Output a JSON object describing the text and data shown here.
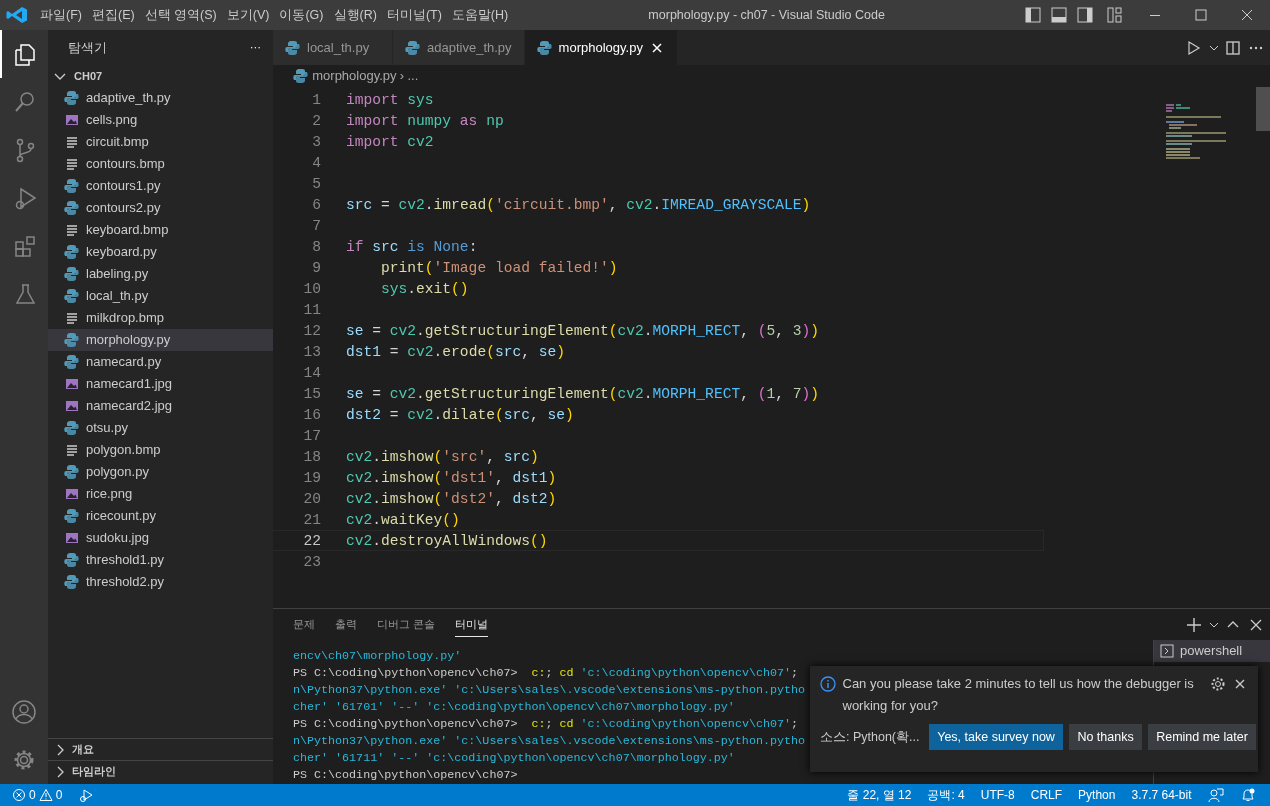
{
  "window": {
    "title": "morphology.py - ch07 - Visual Studio Code"
  },
  "menu": [
    "파일(F)",
    "편집(E)",
    "선택 영역(S)",
    "보기(V)",
    "이동(G)",
    "실행(R)",
    "터미널(T)",
    "도움말(H)"
  ],
  "activity_bar": [
    {
      "kind": "files",
      "selected": true
    },
    {
      "kind": "search",
      "selected": false
    },
    {
      "kind": "source",
      "selected": false
    },
    {
      "kind": "debug",
      "selected": false
    },
    {
      "kind": "extensions",
      "selected": false
    },
    {
      "kind": "flask",
      "selected": false
    }
  ],
  "sidebar": {
    "title": "탐색기",
    "more": "···",
    "folder": {
      "name": "CH07",
      "expanded": true
    },
    "items": [
      {
        "name": "adaptive_th.py",
        "kind": "py",
        "selected": false
      },
      {
        "name": "cells.png",
        "kind": "image",
        "selected": false
      },
      {
        "name": "circuit.bmp",
        "kind": "bmp",
        "selected": false
      },
      {
        "name": "contours.bmp",
        "kind": "bmp",
        "selected": false
      },
      {
        "name": "contours1.py",
        "kind": "py",
        "selected": false
      },
      {
        "name": "contours2.py",
        "kind": "py",
        "selected": false
      },
      {
        "name": "keyboard.bmp",
        "kind": "bmp",
        "selected": false
      },
      {
        "name": "keyboard.py",
        "kind": "py",
        "selected": false
      },
      {
        "name": "labeling.py",
        "kind": "py",
        "selected": false
      },
      {
        "name": "local_th.py",
        "kind": "py",
        "selected": false
      },
      {
        "name": "milkdrop.bmp",
        "kind": "bmp",
        "selected": false
      },
      {
        "name": "morphology.py",
        "kind": "py",
        "selected": true
      },
      {
        "name": "namecard.py",
        "kind": "py",
        "selected": false
      },
      {
        "name": "namecard1.jpg",
        "kind": "image",
        "selected": false
      },
      {
        "name": "namecard2.jpg",
        "kind": "image",
        "selected": false
      },
      {
        "name": "otsu.py",
        "kind": "py",
        "selected": false
      },
      {
        "name": "polygon.bmp",
        "kind": "bmp",
        "selected": false
      },
      {
        "name": "polygon.py",
        "kind": "py",
        "selected": false
      },
      {
        "name": "rice.png",
        "kind": "image",
        "selected": false
      },
      {
        "name": "ricecount.py",
        "kind": "py",
        "selected": false
      },
      {
        "name": "sudoku.jpg",
        "kind": "image",
        "selected": false
      },
      {
        "name": "threshold1.py",
        "kind": "py",
        "selected": false
      },
      {
        "name": "threshold2.py",
        "kind": "py",
        "selected": false
      }
    ],
    "sections": [
      {
        "label": "개요",
        "expanded": false
      },
      {
        "label": "타임라인",
        "expanded": false
      }
    ]
  },
  "tabs": [
    {
      "label": "local_th.py",
      "selected": false
    },
    {
      "label": "adaptive_th.py",
      "selected": false
    },
    {
      "label": "morphology.py",
      "selected": true
    }
  ],
  "breadcrumb": [
    "morphology.py",
    "›",
    "..."
  ],
  "code": [
    {
      "number": "1",
      "current": false,
      "tokens": [
        {
          "kind": "kw",
          "t": "import "
        },
        {
          "kind": "mod",
          "t": "sys"
        }
      ]
    },
    {
      "number": "2",
      "current": false,
      "tokens": [
        {
          "kind": "kw",
          "t": "import "
        },
        {
          "kind": "mod",
          "t": "numpy "
        },
        {
          "kind": "kw",
          "t": "as "
        },
        {
          "kind": "mod",
          "t": "np"
        }
      ]
    },
    {
      "number": "3",
      "current": false,
      "tokens": [
        {
          "kind": "kw",
          "t": "import "
        },
        {
          "kind": "mod",
          "t": "cv2"
        }
      ]
    },
    {
      "number": "4",
      "current": false
    },
    {
      "number": "5",
      "current": false
    },
    {
      "number": "6",
      "current": false,
      "tokens": [
        {
          "kind": "var",
          "t": "src"
        },
        {
          "kind": "op",
          "t": " = "
        },
        {
          "kind": "mod",
          "t": "cv2"
        },
        {
          "kind": "op",
          "t": "."
        },
        {
          "kind": "fn",
          "t": "imread"
        },
        {
          "kind": "p1",
          "t": "("
        },
        {
          "kind": "str",
          "t": "'circuit.bmp'"
        },
        {
          "kind": "op",
          "t": ", "
        },
        {
          "kind": "mod",
          "t": "cv2"
        },
        {
          "kind": "op",
          "t": "."
        },
        {
          "kind": "const",
          "t": "IMREAD_GRAYSCALE"
        },
        {
          "kind": "p1",
          "t": ")"
        }
      ]
    },
    {
      "number": "7",
      "current": false
    },
    {
      "number": "8",
      "current": false,
      "tokens": [
        {
          "kind": "kw",
          "t": "if "
        },
        {
          "kind": "var",
          "t": "src "
        },
        {
          "kind": "kw2",
          "t": "is None"
        },
        {
          "kind": "op",
          "t": ":"
        }
      ]
    },
    {
      "number": "9",
      "current": false,
      "tokens": [
        {
          "kind": "fn",
          "t": "    print"
        },
        {
          "kind": "p1",
          "t": "("
        },
        {
          "kind": "str",
          "t": "'Image load failed!'"
        },
        {
          "kind": "p1",
          "t": ")"
        }
      ]
    },
    {
      "number": "10",
      "current": false,
      "tokens": [
        {
          "kind": "mod",
          "t": "    sys"
        },
        {
          "kind": "op",
          "t": "."
        },
        {
          "kind": "fn",
          "t": "exit"
        },
        {
          "kind": "p1",
          "t": "()"
        }
      ]
    },
    {
      "number": "11",
      "current": false
    },
    {
      "number": "12",
      "current": false,
      "tokens": [
        {
          "kind": "var",
          "t": "se"
        },
        {
          "kind": "op",
          "t": " = "
        },
        {
          "kind": "mod",
          "t": "cv2"
        },
        {
          "kind": "op",
          "t": "."
        },
        {
          "kind": "fn",
          "t": "getStructuringElement"
        },
        {
          "kind": "p1",
          "t": "("
        },
        {
          "kind": "mod",
          "t": "cv2"
        },
        {
          "kind": "op",
          "t": "."
        },
        {
          "kind": "const",
          "t": "MORPH_RECT"
        },
        {
          "kind": "op",
          "t": ", "
        },
        {
          "kind": "p2",
          "t": "("
        },
        {
          "kind": "num",
          "t": "5"
        },
        {
          "kind": "op",
          "t": ", "
        },
        {
          "kind": "num",
          "t": "3"
        },
        {
          "kind": "p2",
          "t": ")"
        },
        {
          "kind": "p1",
          "t": ")"
        }
      ]
    },
    {
      "number": "13",
      "current": false,
      "tokens": [
        {
          "kind": "var",
          "t": "dst1"
        },
        {
          "kind": "op",
          "t": " = "
        },
        {
          "kind": "mod",
          "t": "cv2"
        },
        {
          "kind": "op",
          "t": "."
        },
        {
          "kind": "fn",
          "t": "erode"
        },
        {
          "kind": "p1",
          "t": "("
        },
        {
          "kind": "var",
          "t": "src"
        },
        {
          "kind": "op",
          "t": ", "
        },
        {
          "kind": "var",
          "t": "se"
        },
        {
          "kind": "p1",
          "t": ")"
        }
      ]
    },
    {
      "number": "14",
      "current": false
    },
    {
      "number": "15",
      "current": false,
      "tokens": [
        {
          "kind": "var",
          "t": "se"
        },
        {
          "kind": "op",
          "t": " = "
        },
        {
          "kind": "mod",
          "t": "cv2"
        },
        {
          "kind": "op",
          "t": "."
        },
        {
          "kind": "fn",
          "t": "getStructuringElement"
        },
        {
          "kind": "p1",
          "t": "("
        },
        {
          "kind": "mod",
          "t": "cv2"
        },
        {
          "kind": "op",
          "t": "."
        },
        {
          "kind": "const",
          "t": "MORPH_RECT"
        },
        {
          "kind": "op",
          "t": ", "
        },
        {
          "kind": "p2",
          "t": "("
        },
        {
          "kind": "num",
          "t": "1"
        },
        {
          "kind": "op",
          "t": ", "
        },
        {
          "kind": "num",
          "t": "7"
        },
        {
          "kind": "p2",
          "t": ")"
        },
        {
          "kind": "p1",
          "t": ")"
        }
      ]
    },
    {
      "number": "16",
      "current": false,
      "tokens": [
        {
          "kind": "var",
          "t": "dst2"
        },
        {
          "kind": "op",
          "t": " = "
        },
        {
          "kind": "mod",
          "t": "cv2"
        },
        {
          "kind": "op",
          "t": "."
        },
        {
          "kind": "fn",
          "t": "dilate"
        },
        {
          "kind": "p1",
          "t": "("
        },
        {
          "kind": "var",
          "t": "src"
        },
        {
          "kind": "op",
          "t": ", "
        },
        {
          "kind": "var",
          "t": "se"
        },
        {
          "kind": "p1",
          "t": ")"
        }
      ]
    },
    {
      "number": "17",
      "current": false
    },
    {
      "number": "18",
      "current": false,
      "tokens": [
        {
          "kind": "mod",
          "t": "cv2"
        },
        {
          "kind": "op",
          "t": "."
        },
        {
          "kind": "fn",
          "t": "imshow"
        },
        {
          "kind": "p1",
          "t": "("
        },
        {
          "kind": "str",
          "t": "'src'"
        },
        {
          "kind": "op",
          "t": ", "
        },
        {
          "kind": "var",
          "t": "src"
        },
        {
          "kind": "p1",
          "t": ")"
        }
      ]
    },
    {
      "number": "19",
      "current": false,
      "tokens": [
        {
          "kind": "mod",
          "t": "cv2"
        },
        {
          "kind": "op",
          "t": "."
        },
        {
          "kind": "fn",
          "t": "imshow"
        },
        {
          "kind": "p1",
          "t": "("
        },
        {
          "kind": "str",
          "t": "'dst1'"
        },
        {
          "kind": "op",
          "t": ", "
        },
        {
          "kind": "var",
          "t": "dst1"
        },
        {
          "kind": "p1",
          "t": ")"
        }
      ]
    },
    {
      "number": "20",
      "current": false,
      "tokens": [
        {
          "kind": "mod",
          "t": "cv2"
        },
        {
          "kind": "op",
          "t": "."
        },
        {
          "kind": "fn",
          "t": "imshow"
        },
        {
          "kind": "p1",
          "t": "("
        },
        {
          "kind": "str",
          "t": "'dst2'"
        },
        {
          "kind": "op",
          "t": ", "
        },
        {
          "kind": "var",
          "t": "dst2"
        },
        {
          "kind": "p1",
          "t": ")"
        }
      ]
    },
    {
      "number": "21",
      "current": false,
      "tokens": [
        {
          "kind": "mod",
          "t": "cv2"
        },
        {
          "kind": "op",
          "t": "."
        },
        {
          "kind": "fn",
          "t": "waitKey"
        },
        {
          "kind": "p1",
          "t": "()"
        }
      ]
    },
    {
      "number": "22",
      "current": true,
      "tokens": [
        {
          "kind": "mod",
          "t": "cv2"
        },
        {
          "kind": "op",
          "t": "."
        },
        {
          "kind": "fn",
          "t": "destroyAllWindows"
        },
        {
          "kind": "p1",
          "t": "()"
        }
      ]
    },
    {
      "number": "23",
      "current": false
    }
  ],
  "panel": {
    "tabs": [
      {
        "label": "문제",
        "selected": false
      },
      {
        "label": "출력",
        "selected": false
      },
      {
        "label": "디버그 콘솔",
        "selected": false
      },
      {
        "label": "터미널",
        "selected": true
      }
    ],
    "terminal": [
      [
        {
          "kind": "arg",
          "t": "encv\\ch07\\morphology.py'"
        }
      ],
      [
        {
          "kind": "prompt",
          "t": "PS C:\\coding\\python\\opencv\\ch07> "
        },
        {
          "kind": "cmd",
          "t": " c:"
        },
        {
          "kind": "plain",
          "t": ";"
        },
        {
          "kind": "cmd",
          "t": " cd"
        },
        {
          "kind": "arg",
          "t": " 'c:\\coding\\python\\opencv\\ch07'"
        },
        {
          "kind": "plain",
          "t": ";"
        }
      ],
      [
        {
          "kind": "arg",
          "t": "n\\Python37\\python.exe' 'c:\\Users\\sales\\.vscode\\extensions\\ms-python.pytho"
        }
      ],
      [
        {
          "kind": "arg",
          "t": "cher' '61701' '--' 'c:\\coding\\python\\opencv\\ch07\\morphology.py'"
        }
      ],
      [
        {
          "kind": "prompt",
          "t": "PS C:\\coding\\python\\opencv\\ch07> "
        },
        {
          "kind": "cmd",
          "t": " c:"
        },
        {
          "kind": "plain",
          "t": ";"
        },
        {
          "kind": "cmd",
          "t": " cd"
        },
        {
          "kind": "arg",
          "t": " 'c:\\coding\\python\\opencv\\ch07'"
        },
        {
          "kind": "plain",
          "t": ";"
        }
      ],
      [
        {
          "kind": "arg",
          "t": "n\\Python37\\python.exe' 'c:\\Users\\sales\\.vscode\\extensions\\ms-python.pytho"
        }
      ],
      [
        {
          "kind": "arg",
          "t": "cher' '61711' '--' 'c:\\coding\\python\\opencv\\ch07\\morphology.py'"
        }
      ],
      [
        {
          "kind": "prompt",
          "t": "PS C:\\coding\\python\\opencv\\ch07>"
        }
      ]
    ],
    "terminals": [
      {
        "label": "powershell",
        "selected": true
      }
    ]
  },
  "notification": {
    "message": "Can you please take 2 minutes to tell us how the debugger is working for you?",
    "source": "소스: Python(확...",
    "buttons": [
      {
        "label": "Yes, take survey now",
        "kind": "primary"
      },
      {
        "label": "No thanks",
        "kind": "secondary"
      },
      {
        "label": "Remind me later",
        "kind": "secondary"
      }
    ]
  },
  "status_bar": {
    "errors": "0",
    "warnings": "0",
    "right": [
      "줄 22, 열 12",
      "공백: 4",
      "UTF-8",
      "CRLF",
      "Python",
      "3.7.7 64-bit"
    ]
  }
}
